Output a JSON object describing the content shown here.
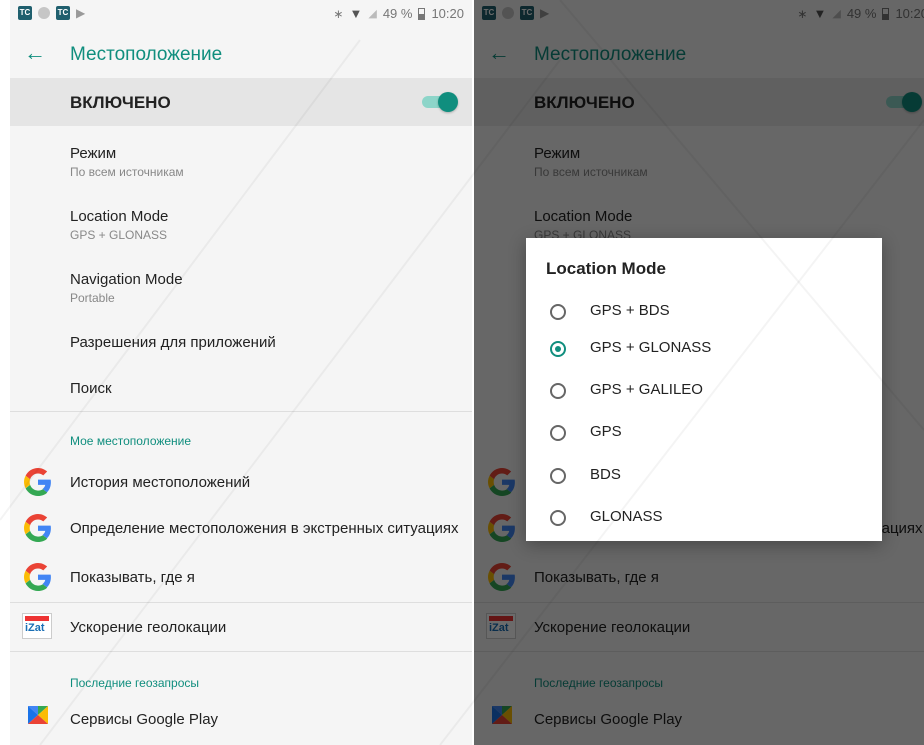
{
  "status_bar": {
    "battery": "49 %",
    "time": "10:20"
  },
  "app_bar": {
    "title": "Местоположение"
  },
  "location_switch": {
    "label": "ВКЛЮЧЕНО",
    "enabled": true
  },
  "settings": [
    {
      "title": "Режим",
      "subtitle": "По всем источникам"
    },
    {
      "title": "Location Mode",
      "subtitle": "GPS + GLONASS"
    },
    {
      "title": "Navigation Mode",
      "subtitle": "Portable"
    },
    {
      "title": "Разрешения для приложений"
    },
    {
      "title": "Поиск"
    }
  ],
  "my_location": {
    "header": "Мое местоположение",
    "items": [
      {
        "label": "История местоположений",
        "icon": "google-g-icon"
      },
      {
        "label": "Определение местоположения в экстренных ситуациях",
        "icon": "google-g-icon"
      },
      {
        "label": "Показывать, где я",
        "icon": "google-g-icon"
      },
      {
        "label": "Ускорение геолокации",
        "icon": "qualcomm-izat-icon"
      }
    ]
  },
  "recent_requests": {
    "header": "Последние геозапросы",
    "items": [
      {
        "label": "Сервисы Google Play",
        "icon": "google-play-services-icon"
      }
    ]
  },
  "dialog": {
    "title": "Location Mode",
    "options": [
      "GPS + BDS",
      "GPS + GLONASS",
      "GPS + GALILEO",
      "GPS",
      "BDS",
      "GLONASS"
    ],
    "selected": "GPS + GLONASS"
  },
  "colors": {
    "accent": "#108e7e"
  }
}
